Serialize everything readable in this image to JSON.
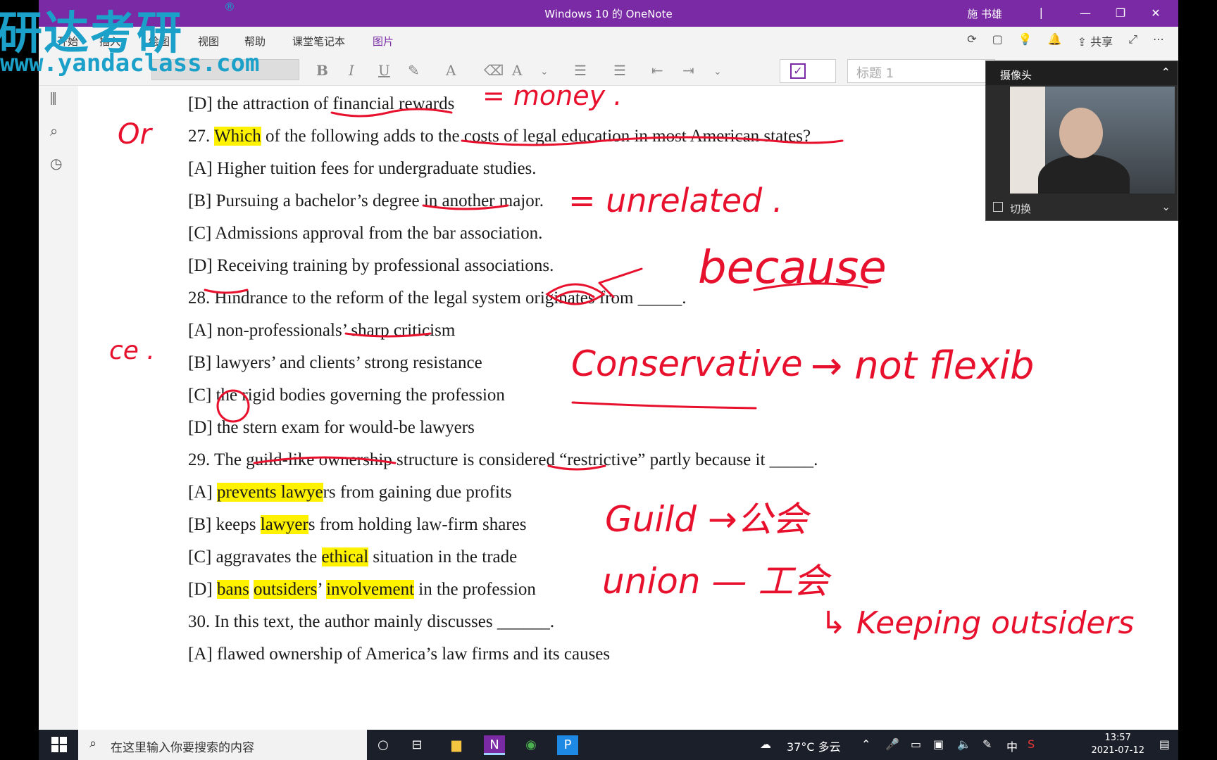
{
  "window": {
    "title": "Windows 10 的 OneNote",
    "user": "施 书雄",
    "separator": "|",
    "minimize": "—",
    "restore": "❐",
    "close": "✕"
  },
  "watermark": {
    "brand": "研达考研",
    "url": "www.yandaclass.com",
    "registered": "®"
  },
  "ribbon_tabs": [
    {
      "label": "开始"
    },
    {
      "label": "插入"
    },
    {
      "label": "绘图"
    },
    {
      "label": "视图"
    },
    {
      "label": "帮助"
    },
    {
      "label": "课堂笔记本"
    },
    {
      "label": "图片"
    }
  ],
  "ribbon_right": {
    "share": "共享"
  },
  "toolbar": {
    "bold": "B",
    "italic": "I",
    "underline": "U",
    "style_value": "标题 1",
    "check": "✓"
  },
  "camera": {
    "title": "摄像头",
    "switch_label": "切换"
  },
  "document": {
    "lines": [
      {
        "text": "[D] the attraction of financial rewards"
      },
      {
        "pre": "27. ",
        "hl": "Which",
        "post": " of the following adds to the costs of legal education in most American states?"
      },
      {
        "text": "[A] Higher tuition fees for undergraduate studies."
      },
      {
        "text": "[B] Pursuing a bachelor’s degree in another major."
      },
      {
        "text": "[C] Admissions approval from the bar association."
      },
      {
        "text": "[D] Receiving training by professional associations."
      },
      {
        "text": "28. Hindrance to the reform of the legal system originates from _____."
      },
      {
        "text": "[A] non-professionals’ sharp criticism"
      },
      {
        "text": "[B] lawyers’ and clients’ strong resistance"
      },
      {
        "text": "[C] the rigid bodies governing the profession"
      },
      {
        "text": "[D] the stern exam for would-be lawyers"
      },
      {
        "text": "29. The guild-like ownership structure is considered “restrictive” partly because it _____."
      },
      {
        "pre": "[A] ",
        "hl": "prevents lawye",
        "post": "rs from gaining due profits"
      },
      {
        "pre": "[B] keeps ",
        "hl": "lawyer",
        "post": "s from holding law-firm shares"
      },
      {
        "pre": "[C] aggravates the ",
        "hl": "ethical",
        "post": " situation in the trade"
      },
      {
        "pre": "[D] ",
        "hl": "bans",
        "mid1": " ",
        "hl2": "outsiders",
        "mid2": "’ ",
        "hl3": "involvement",
        "post": " in the profession"
      },
      {
        "text": "30. In this text, the author mainly discusses ______."
      },
      {
        "text": "[A] flawed ownership of America’s law firms and its causes"
      }
    ]
  },
  "annotations": {
    "money": "= money .",
    "or": "Or",
    "unrelated": "= unrelated .",
    "because": "because",
    "ce": "ce .",
    "conservative": "Conservative",
    "arrow_not_flexible": "→ not flexib",
    "guild": "Guild →公会",
    "union": "union — 工会",
    "keeping": "↳ Keeping outsiders"
  },
  "taskbar": {
    "search_placeholder": "在这里输入你要搜索的内容",
    "weather": "37°C 多云",
    "ime": "中",
    "time": "13:57",
    "date": "2021-07-12"
  }
}
